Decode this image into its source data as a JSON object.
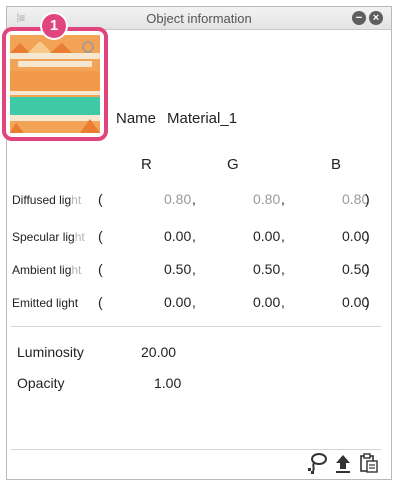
{
  "window": {
    "menu_icon": "menu-icon",
    "title": "Object information",
    "minimize_icon": "minimize-icon",
    "close_icon": "close-icon"
  },
  "thumbnail": {
    "callout_number": "1",
    "colors": {
      "orange": "#f2a356",
      "teal": "#3ec9a7",
      "light": "#f6e8d0",
      "border": "#e0457d"
    }
  },
  "name": {
    "label": "Name",
    "value": "Material_1"
  },
  "columns": [
    "R",
    "G",
    "B"
  ],
  "rows": [
    {
      "label_a": "Diffused lig",
      "label_b": "ht",
      "open": "(",
      "r": "0.80",
      "g": "0.80",
      "b": "0.80",
      "sep": ",",
      "close": ")",
      "dim": true
    },
    {
      "label_a": "Specular lig",
      "label_b": "ht",
      "open": "(",
      "r": "0.00",
      "g": "0.00",
      "b": "0.00",
      "sep": ",",
      "close": ")",
      "dim": false
    },
    {
      "label_a": "Ambient lig",
      "label_b": "ht",
      "open": "(",
      "r": "0.50",
      "g": "0.50",
      "b": "0.50",
      "sep": ",",
      "close": ")",
      "dim": false
    },
    {
      "label_a": "Emitted light",
      "label_b": "",
      "open": "(",
      "r": "0.00",
      "g": "0.00",
      "b": "0.00",
      "sep": ",",
      "close": ")",
      "dim": false
    }
  ],
  "luminosity": {
    "label": "Luminosity",
    "value": "20.00"
  },
  "opacity": {
    "label": "Opacity",
    "value": "1.00"
  },
  "footer": {
    "icons": [
      "lasso-icon",
      "upload-icon",
      "clipboard-icon"
    ]
  }
}
